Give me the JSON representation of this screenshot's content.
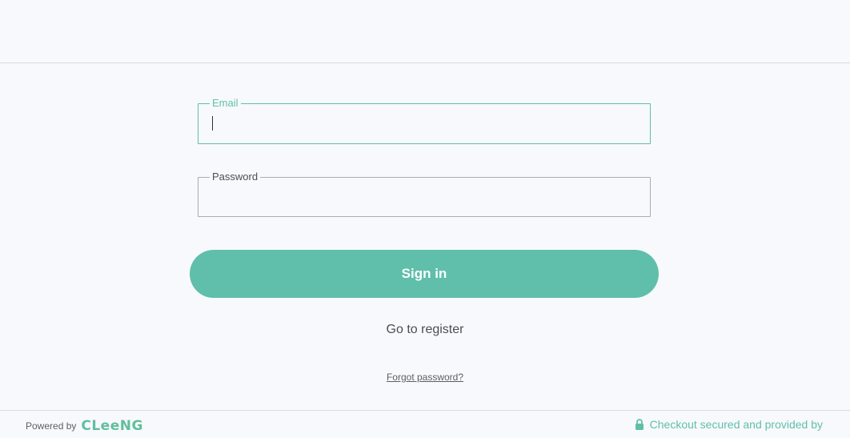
{
  "form": {
    "email": {
      "label": "Email",
      "value": ""
    },
    "password": {
      "label": "Password",
      "value": ""
    },
    "signin_label": "Sign in",
    "register_label": "Go to register",
    "forgot_label": "Forgot password?"
  },
  "footer": {
    "powered_label": "Powered by",
    "brand": "CLeeNG",
    "secure_label": "Checkout secured and provided by",
    "icons": {
      "lock": "lock-icon"
    }
  },
  "colors": {
    "accent": "#5fbfab",
    "background": "#f8f9fd",
    "text": "#4b4e55"
  }
}
